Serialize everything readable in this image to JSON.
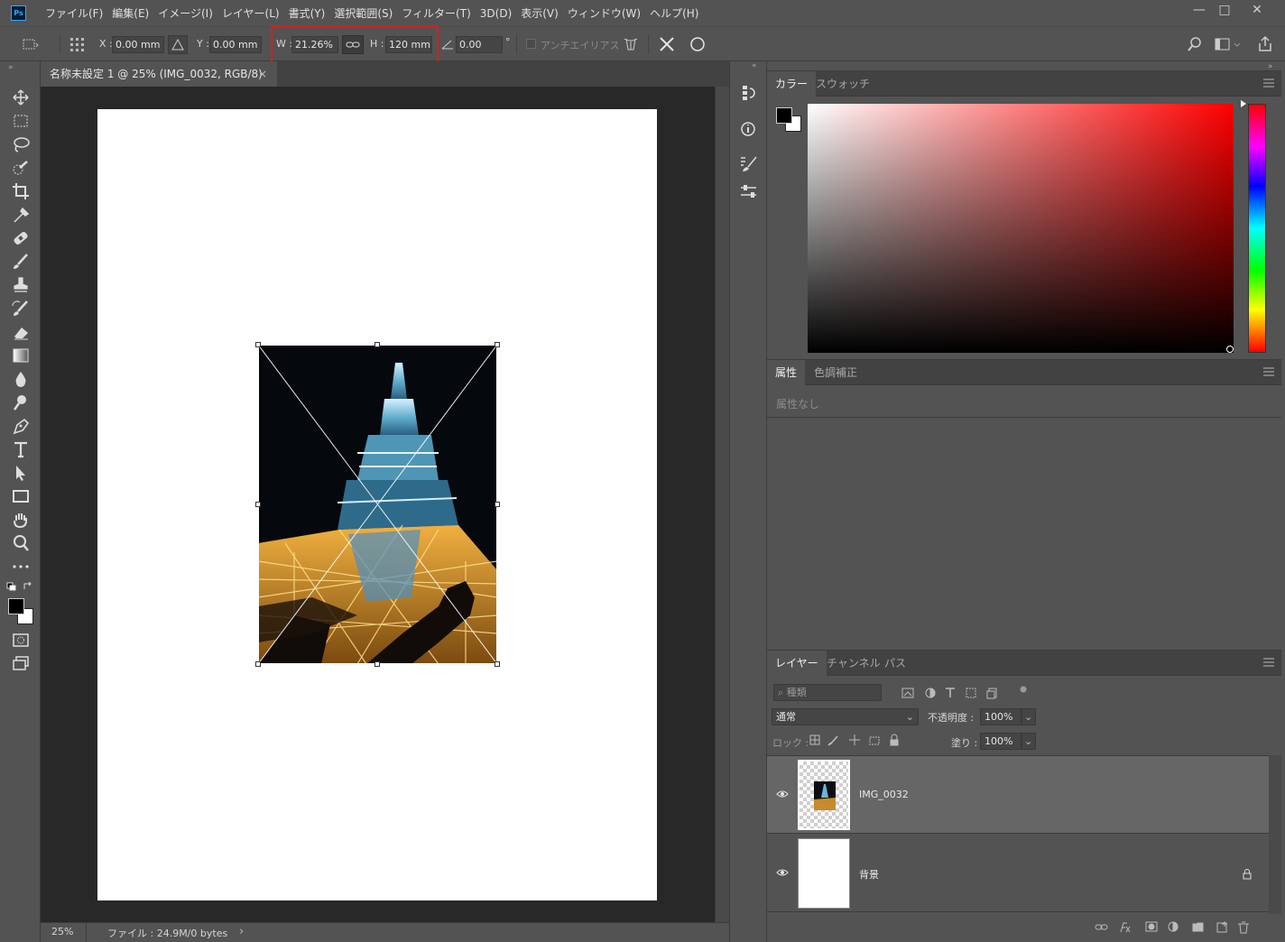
{
  "app": {
    "logo": "Ps"
  },
  "menu": [
    "ファイル(F)",
    "編集(E)",
    "イメージ(I)",
    "レイヤー(L)",
    "書式(Y)",
    "選択範囲(S)",
    "フィルター(T)",
    "3D(D)",
    "表示(V)",
    "ウィンドウ(W)",
    "ヘルプ(H)"
  ],
  "window_controls": {
    "minimize": "—",
    "maximize": "□",
    "close": "✕"
  },
  "options": {
    "x_label": "X :",
    "x_value": "0.00 mm",
    "y_label": "Y :",
    "y_value": "0.00 mm",
    "w_label": "W :",
    "w_value": "21.26%",
    "h_label": "H :",
    "h_value": "120 mm",
    "angle_value": "0.00",
    "angle_unit": "°",
    "antialias_label": "アンチエイリアス"
  },
  "document": {
    "tab_title": "名称未設定 1 @ 25% (IMG_0032, RGB/8)",
    "tab_close": "×",
    "zoom": "25%",
    "file_info": "ファイル : 24.9M/0 bytes",
    "status_arrow": "›"
  },
  "color_panel": {
    "tabs": [
      "カラー",
      "スウォッチ"
    ]
  },
  "properties_panel": {
    "tabs": [
      "属性",
      "色調補正"
    ],
    "empty_text": "属性なし"
  },
  "layers_panel": {
    "tabs": [
      "レイヤー",
      "チャンネル",
      "パス"
    ],
    "filter_placeholder": "種類",
    "blend_mode": "通常",
    "opacity_label": "不透明度 :",
    "opacity_value": "100%",
    "lock_label": "ロック :",
    "fill_label": "塗り :",
    "fill_value": "100%",
    "layers": [
      {
        "name": "IMG_0032",
        "selected": true,
        "visible": true
      },
      {
        "name": "背景",
        "selected": false,
        "visible": true,
        "locked": true
      }
    ]
  },
  "colors": {
    "highlight": "#d81e1e",
    "ps_blue": "#31a8ff",
    "foreground": "#000000",
    "background": "#ffffff",
    "hue": "#ff0000"
  }
}
